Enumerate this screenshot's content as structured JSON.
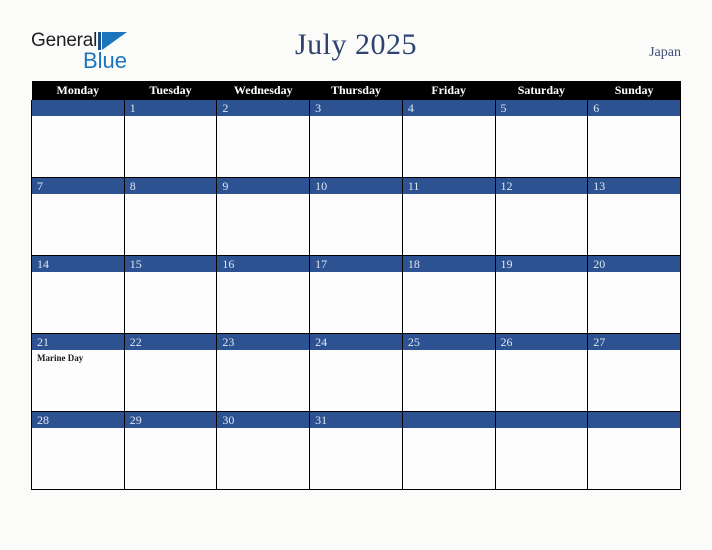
{
  "brand": {
    "name_part1": "General",
    "name_part2": "Blue",
    "logo_icon": "triangle-flag-icon",
    "color_dark": "#231f20",
    "color_blue": "#1b75bc"
  },
  "header": {
    "title": "July 2025",
    "country": "Japan",
    "title_color": "#2e4370"
  },
  "calendar": {
    "accent_color": "#2d5291",
    "header_bg": "#000000",
    "weekday_headers": [
      "Monday",
      "Tuesday",
      "Wednesday",
      "Thursday",
      "Friday",
      "Saturday",
      "Sunday"
    ],
    "weeks": [
      [
        {
          "day": "",
          "events": []
        },
        {
          "day": "1",
          "events": []
        },
        {
          "day": "2",
          "events": []
        },
        {
          "day": "3",
          "events": []
        },
        {
          "day": "4",
          "events": []
        },
        {
          "day": "5",
          "events": []
        },
        {
          "day": "6",
          "events": []
        }
      ],
      [
        {
          "day": "7",
          "events": []
        },
        {
          "day": "8",
          "events": []
        },
        {
          "day": "9",
          "events": []
        },
        {
          "day": "10",
          "events": []
        },
        {
          "day": "11",
          "events": []
        },
        {
          "day": "12",
          "events": []
        },
        {
          "day": "13",
          "events": []
        }
      ],
      [
        {
          "day": "14",
          "events": []
        },
        {
          "day": "15",
          "events": []
        },
        {
          "day": "16",
          "events": []
        },
        {
          "day": "17",
          "events": []
        },
        {
          "day": "18",
          "events": []
        },
        {
          "day": "19",
          "events": []
        },
        {
          "day": "20",
          "events": []
        }
      ],
      [
        {
          "day": "21",
          "events": [
            "Marine Day"
          ]
        },
        {
          "day": "22",
          "events": []
        },
        {
          "day": "23",
          "events": []
        },
        {
          "day": "24",
          "events": []
        },
        {
          "day": "25",
          "events": []
        },
        {
          "day": "26",
          "events": []
        },
        {
          "day": "27",
          "events": []
        }
      ],
      [
        {
          "day": "28",
          "events": []
        },
        {
          "day": "29",
          "events": []
        },
        {
          "day": "30",
          "events": []
        },
        {
          "day": "31",
          "events": []
        },
        {
          "day": "",
          "events": []
        },
        {
          "day": "",
          "events": []
        },
        {
          "day": "",
          "events": []
        }
      ]
    ]
  }
}
